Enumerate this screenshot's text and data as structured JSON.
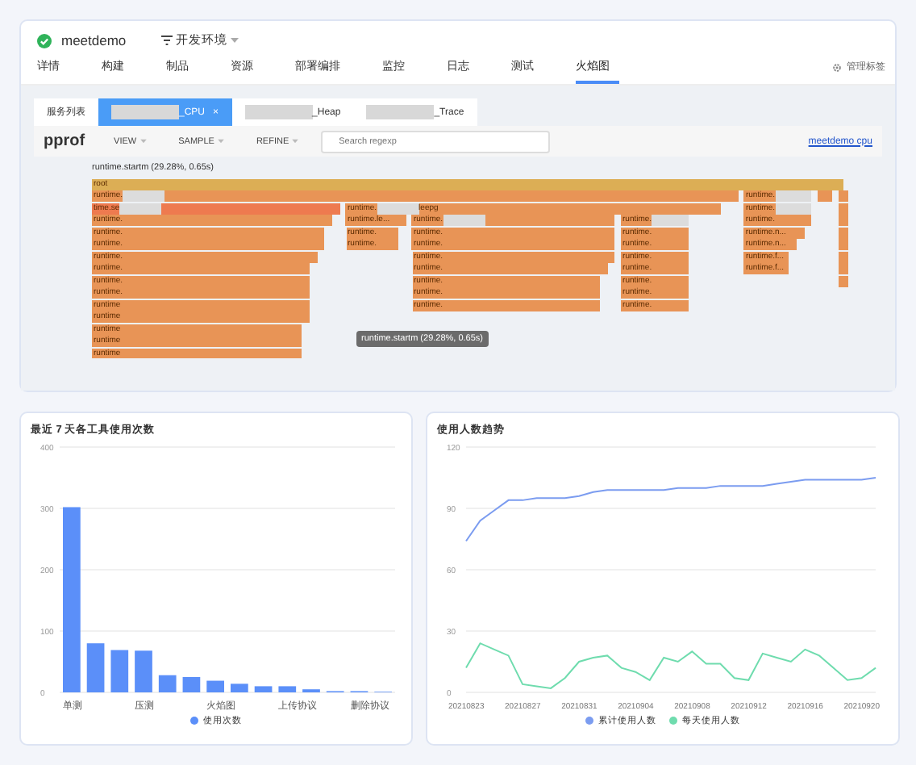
{
  "app": {
    "name": "meetdemo",
    "status_ok": true,
    "environment": "开发环境"
  },
  "tabs": [
    {
      "label": "详情",
      "selected": false
    },
    {
      "label": "构建",
      "selected": false
    },
    {
      "label": "制品",
      "selected": false
    },
    {
      "label": "资源",
      "selected": false
    },
    {
      "label": "部署编排",
      "selected": false
    },
    {
      "label": "监控",
      "selected": false
    },
    {
      "label": "日志",
      "selected": false
    },
    {
      "label": "测试",
      "selected": false
    },
    {
      "label": "火焰图",
      "selected": true
    }
  ],
  "manage_tags": "管理标签",
  "service_tabs": [
    {
      "label": "服务列表",
      "redacted": false,
      "selected": false
    },
    {
      "label": "_CPU",
      "redacted": true,
      "selected": true,
      "close": "×"
    },
    {
      "label": "_Heap",
      "redacted": true,
      "selected": false
    },
    {
      "label": "_Trace",
      "redacted": true,
      "selected": false
    }
  ],
  "pprof": {
    "logo": "pprof",
    "menus": [
      "VIEW",
      "SAMPLE",
      "REFINE"
    ],
    "search": {
      "placeholder": "Search regexp"
    },
    "link": "meetdemo cpu",
    "heading": "runtime.startm (29.28%, 0.65s)",
    "tooltip": "runtime.startm (29.28%, 0.65s)",
    "flame": {
      "label": "root",
      "kind": "root",
      "children": [
        {
          "label": "runtime.",
          "redacted": true,
          "children": [
            {
              "label": "time.se",
              "kind": "hot",
              "redacted": true,
              "children": [
                {
                  "label": "runtime.",
                  "children": [
                    {
                      "label": "runtime.",
                      "children": [
                        {
                          "label": "runtime.",
                          "children": [
                            {
                              "label": "runtime.",
                              "children": [
                                {
                                  "label": "runtime.",
                                  "children": [
                                    {
                                      "label": "runtime.",
                                      "children": [
                                        {
                                          "label": "runtime.",
                                          "children": [
                                            {
                                              "label": "runtime",
                                              "children": [
                                                {
                                                  "label": "runtime",
                                                  "children": [
                                                    {
                                                      "label": "runtime",
                                                      "children": [
                                                        {
                                                          "label": "runtime",
                                                          "children": [
                                                            {
                                                              "label": "runtime"
                                                            }
                                                          ]
                                                        }
                                                      ]
                                                    }
                                                  ]
                                                }
                                              ]
                                            }
                                          ]
                                        }
                                      ]
                                    }
                                  ]
                                }
                              ]
                            }
                          ]
                        }
                      ]
                    }
                  ]
                }
              ]
            },
            {
              "label": "runtime.",
              "redacted": true,
              "suffix": "leepg",
              "children": [
                {
                  "label": "runtime.",
                  "suffix": "le...",
                  "children": [
                    {
                      "label": "runtime.",
                      "children": [
                        {
                          "label": "runtime."
                        }
                      ]
                    }
                  ]
                },
                {
                  "label": "runtime.",
                  "redacted": true,
                  "children": [
                    {
                      "label": "runtime.",
                      "children": [
                        {
                          "label": "runtime.",
                          "children": [
                            {
                              "label": "runtime.",
                              "children": [
                                {
                                  "label": "runtime.",
                                  "children": [
                                    {
                                      "label": "runtime.",
                                      "children": [
                                        {
                                          "label": "runtime.",
                                          "children": [
                                            {
                                              "label": "runtime."
                                            }
                                          ]
                                        }
                                      ]
                                    }
                                  ]
                                }
                              ]
                            }
                          ]
                        }
                      ]
                    }
                  ]
                },
                {
                  "label": "runtime.",
                  "redacted": true,
                  "children": [
                    {
                      "label": "runtime.",
                      "children": [
                        {
                          "label": "runtime.",
                          "children": [
                            {
                              "label": "runtime.",
                              "children": [
                                {
                                  "label": "runtime.",
                                  "children": [
                                    {
                                      "label": "runtime.",
                                      "children": [
                                        {
                                          "label": "runtime.",
                                          "children": [
                                            {
                                              "label": "runtime."
                                            }
                                          ]
                                        }
                                      ]
                                    }
                                  ]
                                }
                              ]
                            }
                          ]
                        }
                      ]
                    }
                  ]
                }
              ]
            }
          ]
        },
        {
          "label": "runtime.",
          "redacted": true,
          "children": [
            {
              "label": "runtime.",
              "redacted": true,
              "children": [
                {
                  "label": "runtime.",
                  "children": [
                    {
                      "label": "runtime.n...",
                      "children": [
                        {
                          "label": "runtime.n...",
                          "children": [
                            {
                              "label": "runtime.f...",
                              "children": [
                                {
                                  "label": "runtime.f..."
                                }
                              ]
                            }
                          ]
                        }
                      ]
                    }
                  ]
                }
              ]
            }
          ]
        },
        {
          "kind": "frame"
        },
        {
          "kind": "frame",
          "children": [
            {
              "kind": "frame",
              "children": [
                {
                  "kind": "frame",
                  "children": [
                    {
                      "kind": "frame",
                      "children": [
                        {
                          "kind": "frame",
                          "children": [
                            {
                              "kind": "frame",
                              "children": [
                                {
                                  "kind": "frame",
                                  "children": [
                                    {
                                      "kind": "frame"
                                    }
                                  ]
                                }
                              ]
                            }
                          ]
                        }
                      ]
                    }
                  ]
                }
              ]
            }
          ]
        }
      ]
    }
  },
  "usage_chart": {
    "title": "最近 7 天各工具使用次数",
    "chart_data": {
      "type": "bar",
      "grid": true,
      "categories": [
        "单测",
        null,
        null,
        "压测",
        null,
        null,
        "火焰图",
        null,
        null,
        "上传协议",
        null,
        null,
        "删除协议",
        null
      ],
      "series": [
        {
          "name": "使用次数",
          "color": "#5b8ff9",
          "values": [
            302,
            80,
            69,
            68,
            28,
            25,
            19,
            14,
            10,
            10,
            5,
            2,
            2,
            1
          ]
        }
      ],
      "yticks": [
        0,
        100,
        200,
        300,
        400
      ],
      "ylim": [
        0,
        400
      ]
    }
  },
  "users_chart": {
    "title": "使用人数趋势",
    "chart_data": {
      "type": "line",
      "grid": true,
      "x": [
        "20210823",
        null,
        null,
        null,
        "20210827",
        null,
        null,
        null,
        "20210831",
        null,
        null,
        null,
        "20210904",
        null,
        null,
        null,
        "20210908",
        null,
        null,
        null,
        "20210912",
        null,
        null,
        null,
        "20210916",
        null,
        null,
        null,
        "20210920",
        null
      ],
      "series": [
        {
          "name": "累计使用人数",
          "color": "#7b9cf0",
          "values": [
            74,
            84,
            89,
            94,
            94,
            95,
            95,
            95,
            96,
            98,
            99,
            99,
            99,
            99,
            99,
            100,
            100,
            100,
            101,
            101,
            101,
            101,
            102,
            103,
            104,
            104,
            104,
            104,
            104,
            105
          ]
        },
        {
          "name": "每天使用人数",
          "color": "#6fdcae",
          "values": [
            12,
            24,
            21,
            18,
            4,
            3,
            2,
            7,
            15,
            17,
            18,
            12,
            10,
            6,
            17,
            15,
            20,
            14,
            14,
            7,
            6,
            19,
            17,
            15,
            21,
            18,
            12,
            6,
            7,
            12
          ]
        }
      ],
      "yticks": [
        0,
        30,
        60,
        90,
        120
      ],
      "ylim": [
        0,
        120
      ]
    }
  }
}
